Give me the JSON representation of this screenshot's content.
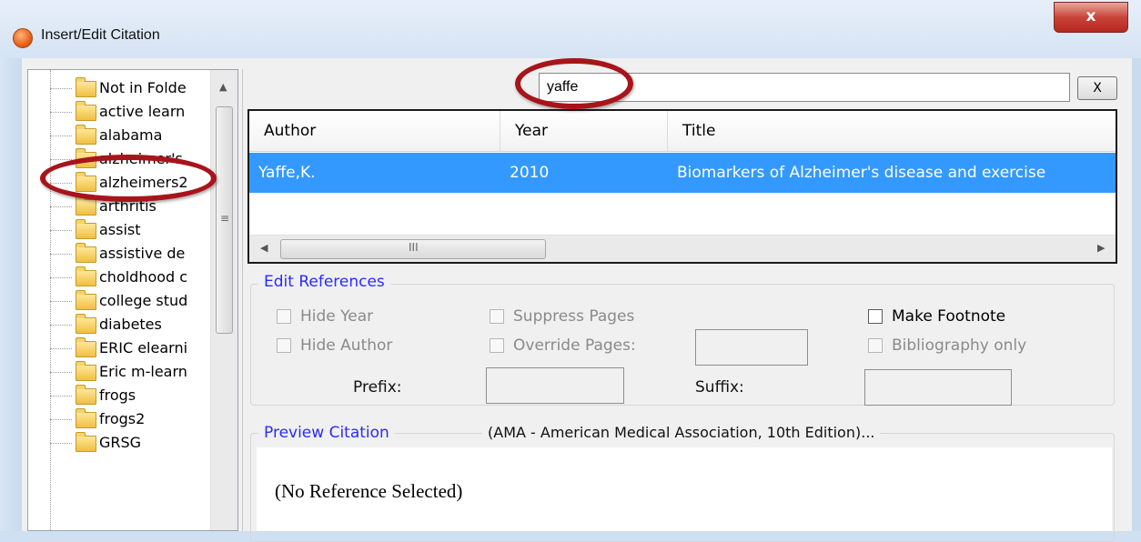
{
  "window": {
    "title": "Insert/Edit Citation",
    "close_glyph": "x"
  },
  "folders": [
    "Not in Folde",
    "active learn",
    "alabama",
    "alzheimer's",
    "alzheimers2",
    "arthritis",
    "assist",
    "assistive de",
    "choldhood c",
    "college stud",
    "diabetes",
    "ERIC elearni",
    "Eric m-learn",
    "frogs",
    "frogs2",
    "GRSG"
  ],
  "search": {
    "value": "yaffe",
    "clear_label": "X"
  },
  "results": {
    "columns": [
      "Author",
      "Year",
      "Title"
    ],
    "rows": [
      {
        "author": "Yaffe,K.",
        "year": "2010",
        "title": "Biomarkers of Alzheimer's disease and exercise"
      }
    ],
    "scroll_grip": "III"
  },
  "edit_references": {
    "legend": "Edit References",
    "hide_year": "Hide Year",
    "hide_author": "Hide Author",
    "suppress_pages": "Suppress Pages",
    "override_pages": "Override Pages:",
    "make_footnote": "Make Footnote",
    "bibliography_only": "Bibliography only",
    "prefix_label": "Prefix:",
    "suffix_label": "Suffix:"
  },
  "preview": {
    "legend": "Preview Citation",
    "style": "(AMA - American Medical Association, 10th Edition)...",
    "text": "(No Reference Selected)"
  },
  "colors": {
    "selection": "#3399ff",
    "legend_text": "#2a2aff",
    "annotation": "#a8141a"
  }
}
